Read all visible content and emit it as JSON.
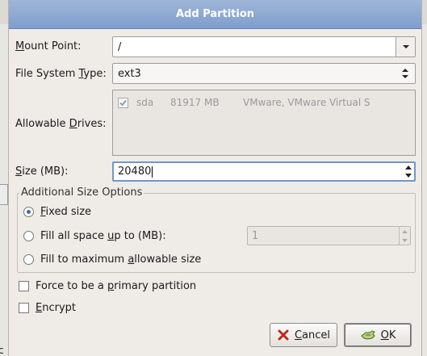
{
  "dialog": {
    "title": "Add Partition"
  },
  "mount_point": {
    "label": "Mount Point:",
    "mnemonic": "M",
    "rest": "ount Point:",
    "value": "/",
    "icon": "chevron-down-icon"
  },
  "fs_type": {
    "label_pre": "File System ",
    "mnemonic": "T",
    "label_post": "ype:",
    "value": "ext3"
  },
  "drives": {
    "label_pre": "Allowable ",
    "mnemonic": "D",
    "label_post": "rives:",
    "items": [
      {
        "checked": true,
        "name": "sda",
        "size": "81917 MB",
        "model": "VMware, VMware Virtual S"
      }
    ]
  },
  "size": {
    "label_pre": "",
    "mnemonic": "S",
    "label_post": "ize (MB):",
    "value": "20480"
  },
  "size_options": {
    "title": "Additional Size Options",
    "fixed": {
      "mnemonic": "F",
      "rest": "ixed size",
      "selected": true
    },
    "fill_up_to": {
      "pre": "Fill all space ",
      "mnemonic": "u",
      "post": "p to (MB):",
      "value": "1",
      "selected": false
    },
    "fill_max": {
      "pre": "Fill to maximum ",
      "mnemonic": "a",
      "post": "llowable size",
      "selected": false
    }
  },
  "primary": {
    "pre": "Force to be a ",
    "mnemonic": "p",
    "post": "rimary partition",
    "checked": false
  },
  "encrypt": {
    "mnemonic": "E",
    "rest": "ncrypt",
    "checked": false
  },
  "buttons": {
    "cancel": {
      "mnemonic": "C",
      "rest": "ancel",
      "icon": "cancel-x-icon"
    },
    "ok": {
      "mnemonic": "O",
      "rest": "K",
      "icon": "ok-hand-icon"
    }
  },
  "background": {
    "fragment": "c"
  },
  "colors": {
    "title_bar": "#8aa6d2",
    "focus": "#7296c8",
    "radio_dot": "#456aa3",
    "cancel_x": "#c0281e",
    "ok_icon": "#6b8f3a"
  }
}
